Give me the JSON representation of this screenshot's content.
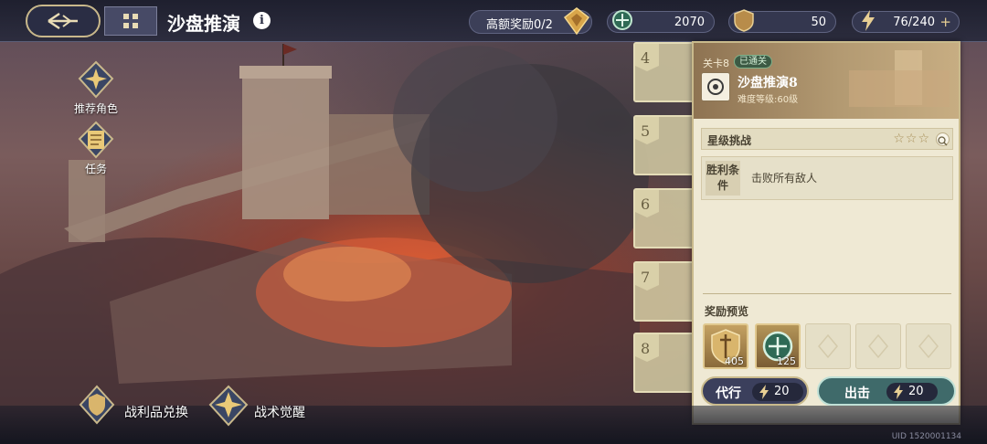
{
  "header": {
    "title": "沙盘推演",
    "reward_label": "高额奖励0/2",
    "resources": [
      {
        "name": "coin",
        "icon": "green-coin-icon",
        "value": "2070"
      },
      {
        "name": "token",
        "icon": "shield-token-icon",
        "value": "50"
      },
      {
        "name": "stamina",
        "icon": "lightning-icon",
        "value": "76/240"
      }
    ],
    "stamina_add": "+"
  },
  "sidebar": {
    "items": [
      {
        "label": "推荐角色",
        "icon": "star-badge-icon"
      },
      {
        "label": "任务",
        "icon": "scroll-icon"
      }
    ]
  },
  "levels": [
    {
      "num": "4"
    },
    {
      "num": "5"
    },
    {
      "num": "6"
    },
    {
      "num": "7"
    },
    {
      "num": "8"
    }
  ],
  "panel": {
    "stage_id": "关卡8",
    "status": "已通关",
    "stage_name": "沙盘推演8",
    "difficulty": "难度等级:60级",
    "star_challenge": "星级挑战",
    "stars": "☆☆☆",
    "victory_label": "胜利条件",
    "victory_text": "击败所有敌人",
    "rewards_title": "奖励预览",
    "rewards": [
      {
        "icon": "shield-sword-reward-icon",
        "count": "405"
      },
      {
        "icon": "green-coin-reward-icon",
        "count": "125"
      }
    ],
    "proxy_label": "代行",
    "proxy_cost": "20",
    "go_label": "出击",
    "go_cost": "20"
  },
  "bottom": {
    "items": [
      {
        "label": "战利品兑换",
        "icon": "shield-emblem-icon"
      },
      {
        "label": "战术觉醒",
        "icon": "star-compass-icon"
      }
    ],
    "uid": "UID 1520001134"
  }
}
